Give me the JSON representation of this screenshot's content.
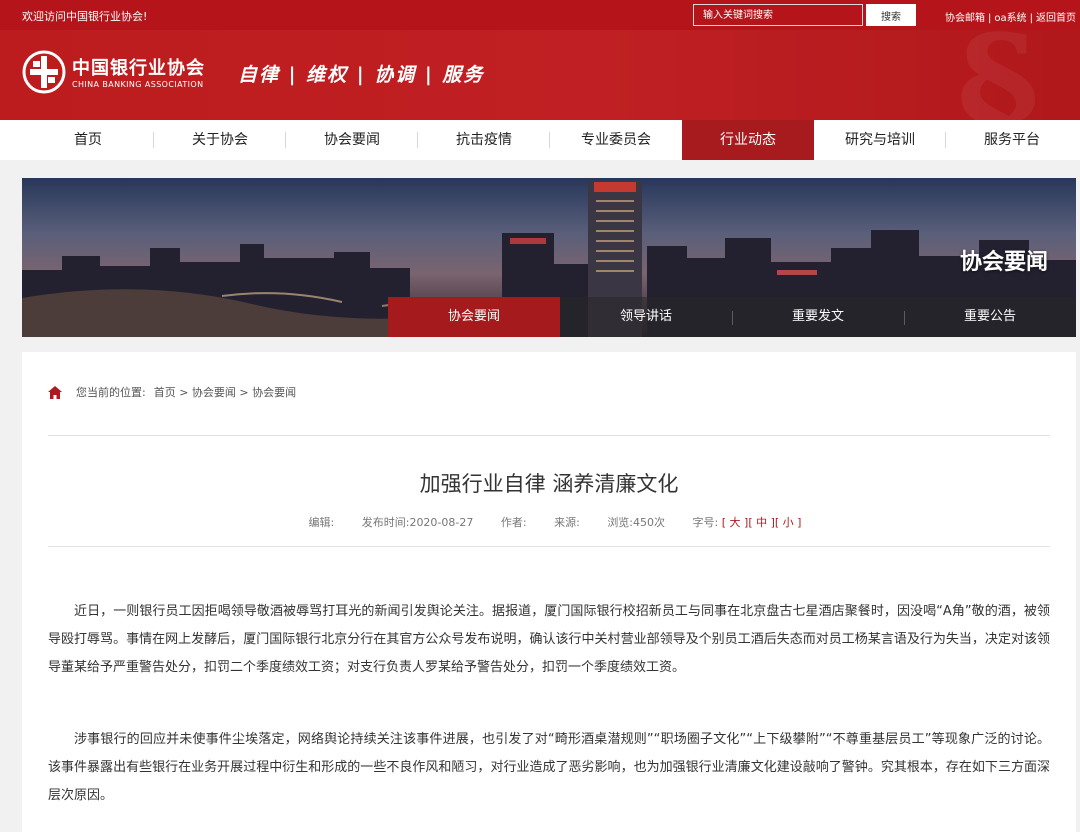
{
  "topbar": {
    "welcome": "欢迎访问中国银行业协会!",
    "search_placeholder": "输入关键词搜索",
    "search_button": "搜索",
    "links": [
      "协会邮箱",
      "oa系统",
      "返回首页"
    ],
    "link_separator": "|"
  },
  "header": {
    "org_name": "中国银行业协会",
    "org_name_en": "CHINA BANKING ASSOCIATION",
    "slogan": "自律 | 维权 | 协调 | 服务"
  },
  "nav": {
    "items": [
      "首页",
      "关于协会",
      "协会要闻",
      "抗击疫情",
      "专业委员会",
      "行业动态",
      "研究与培训",
      "服务平台"
    ],
    "active": "行业动态"
  },
  "banner": {
    "title": "协会要闻",
    "tabs": [
      "协会要闻",
      "领导讲话",
      "重要发文",
      "重要公告"
    ],
    "active_tab": "协会要闻"
  },
  "breadcrumb": {
    "label": "您当前的位置:",
    "path": "首页 > 协会要闻 > 协会要闻"
  },
  "article": {
    "title": "加强行业自律 涵养清廉文化",
    "meta": {
      "editor": "编辑:",
      "date": "发布时间:2020-08-27",
      "author": "作者:",
      "source": "来源:",
      "views": "浏览:450次",
      "font_label": "字号:",
      "font_large": "[ 大 ]",
      "font_medium": "[ 中 ]",
      "font_small": "[ 小 ]"
    },
    "paragraphs": [
      "近日，一则银行员工因拒喝领导敬酒被辱骂打耳光的新闻引发舆论关注。据报道，厦门国际银行校招新员工与同事在北京盘古七星酒店聚餐时，因没喝“A角”敬的酒，被领导殴打辱骂。事情在网上发酵后，厦门国际银行北京分行在其官方公众号发布说明，确认该行中关村营业部领导及个别员工酒后失态而对员工杨某言语及行为失当，决定对该领导董某给予严重警告处分，扣罚二个季度绩效工资；对支行负责人罗某给予警告处分，扣罚一个季度绩效工资。",
      "涉事银行的回应并未使事件尘埃落定，网络舆论持续关注该事件进展，也引发了对“畸形酒桌潜规则”“职场圈子文化”“上下级攀附”“不尊重基层员工”等现象广泛的讨论。该事件暴露出有些银行在业务开展过程中衍生和形成的一些不良作风和陋习，对行业造成了恶劣影响，也为加强银行业清廉文化建设敲响了警钟。究其根本，存在如下三方面深层次原因。"
    ]
  },
  "colors": {
    "brand_red": "#b5141a",
    "nav_active": "#a71a1e",
    "page_bg": "#f1f1f1"
  },
  "icons": [
    "logo-icon",
    "home-icon"
  ]
}
